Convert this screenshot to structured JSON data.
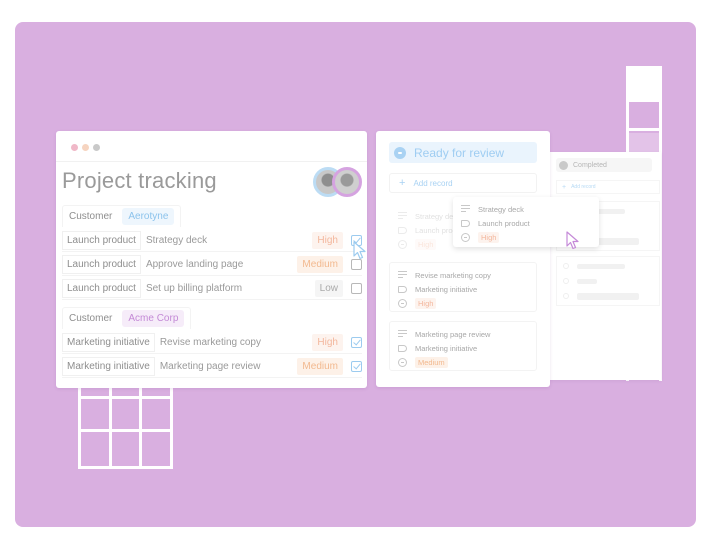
{
  "colors": {
    "background": "#d9afe0",
    "accent_blue": "#9fcdf2",
    "accent_purple": "#c48ad6",
    "priority_high": "#f3b79d",
    "priority_medium": "#f2b98f",
    "priority_low": "#aaaaaa"
  },
  "window": {
    "controls": [
      "close",
      "minimize",
      "maximize"
    ]
  },
  "project_card": {
    "title": "Project tracking",
    "avatars": [
      {
        "name": "avatar-woman",
        "ring": "#bcdcf4"
      },
      {
        "name": "avatar-man",
        "ring": "#d5a3e0"
      }
    ],
    "groups": [
      {
        "label": "Customer",
        "customer": "Aerotyne",
        "rows": [
          {
            "project": "Launch product",
            "task": "Strategy deck",
            "priority": "High",
            "done": true
          },
          {
            "project": "Launch product",
            "task": "Approve landing page",
            "priority": "Medium",
            "done": false
          },
          {
            "project": "Launch product",
            "task": "Set up billing platform",
            "priority": "Low",
            "done": false
          }
        ]
      },
      {
        "label": "Customer",
        "customer": "Acme Corp",
        "rows": [
          {
            "project": "Marketing initiative",
            "task": "Revise marketing copy",
            "priority": "High",
            "done": true
          },
          {
            "project": "Marketing initiative",
            "task": "Marketing page review",
            "priority": "Medium",
            "done": true
          }
        ]
      }
    ]
  },
  "board": {
    "columns": [
      {
        "title": "Ready for review",
        "add_label": "Add record",
        "add_icon": "+",
        "cards": [
          {
            "title": "Strategy deck",
            "project": "Launch product",
            "priority": "High",
            "ghost": true
          },
          {
            "title": "Revise marketing copy",
            "project": "Marketing initiative",
            "priority": "High"
          },
          {
            "title": "Marketing page review",
            "project": "Marketing initiative",
            "priority": "Medium"
          }
        ]
      },
      {
        "title": "Completed",
        "add_label": "Add record",
        "add_icon": "+"
      }
    ],
    "dragging_card": {
      "title": "Strategy deck",
      "project": "Launch product",
      "priority": "High"
    }
  }
}
